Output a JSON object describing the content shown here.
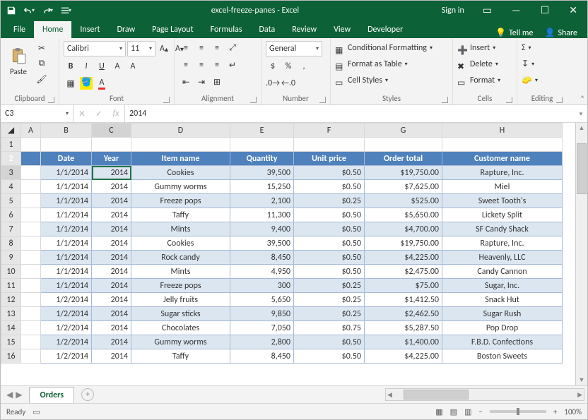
{
  "titlebar": {
    "title": "excel-freeze-panes - Excel",
    "signin": "Sign in"
  },
  "tabs": {
    "file": "File",
    "home": "Home",
    "insert": "Insert",
    "draw": "Draw",
    "pagelayout": "Page Layout",
    "formulas": "Formulas",
    "data": "Data",
    "review": "Review",
    "view": "View",
    "developer": "Developer",
    "tellme": "Tell me",
    "share": "Share"
  },
  "ribbon": {
    "paste": "Paste",
    "font_name": "Calibri",
    "font_size": "11",
    "number_format": "General",
    "cond_fmt": "Conditional Formatting",
    "fmt_table": "Format as Table",
    "cell_styles": "Cell Styles",
    "insert_btn": "Insert",
    "delete_btn": "Delete",
    "format_btn": "Format",
    "groups": {
      "clipboard": "Clipboard",
      "font": "Font",
      "alignment": "Alignment",
      "number": "Number",
      "styles": "Styles",
      "cells": "Cells",
      "editing": "Editing"
    }
  },
  "namebox": "C3",
  "formula": "2014",
  "columns": [
    "A",
    "B",
    "C",
    "D",
    "E",
    "F",
    "G",
    "H"
  ],
  "row_numbers": [
    1,
    2,
    3,
    4,
    5,
    6,
    7,
    8,
    9,
    10,
    11,
    12,
    13,
    14,
    15,
    16
  ],
  "headers": [
    "Date",
    "Year",
    "Item name",
    "Quantity",
    "Unit price",
    "Order total",
    "Customer name"
  ],
  "rows": [
    {
      "date": "1/1/2014",
      "year": "2014",
      "item": "Cookies",
      "qty": "39,500",
      "price": "$0.50",
      "total": "$19,750.00",
      "cust": "Rapture, Inc."
    },
    {
      "date": "1/1/2014",
      "year": "2014",
      "item": "Gummy worms",
      "qty": "15,250",
      "price": "$0.50",
      "total": "$7,625.00",
      "cust": "Miel"
    },
    {
      "date": "1/1/2014",
      "year": "2014",
      "item": "Freeze pops",
      "qty": "2,100",
      "price": "$0.25",
      "total": "$525.00",
      "cust": "Sweet Tooth's"
    },
    {
      "date": "1/1/2014",
      "year": "2014",
      "item": "Taffy",
      "qty": "11,300",
      "price": "$0.50",
      "total": "$5,650.00",
      "cust": "Lickety Split"
    },
    {
      "date": "1/1/2014",
      "year": "2014",
      "item": "Mints",
      "qty": "9,400",
      "price": "$0.50",
      "total": "$4,700.00",
      "cust": "SF Candy Shack"
    },
    {
      "date": "1/1/2014",
      "year": "2014",
      "item": "Cookies",
      "qty": "39,500",
      "price": "$0.50",
      "total": "$19,750.00",
      "cust": "Rapture, Inc."
    },
    {
      "date": "1/1/2014",
      "year": "2014",
      "item": "Rock candy",
      "qty": "8,450",
      "price": "$0.50",
      "total": "$4,225.00",
      "cust": "Heavenly, LLC"
    },
    {
      "date": "1/1/2014",
      "year": "2014",
      "item": "Mints",
      "qty": "4,950",
      "price": "$0.50",
      "total": "$2,475.00",
      "cust": "Candy Cannon"
    },
    {
      "date": "1/1/2014",
      "year": "2014",
      "item": "Freeze pops",
      "qty": "300",
      "price": "$0.25",
      "total": "$75.00",
      "cust": "Sugar, Inc."
    },
    {
      "date": "1/2/2014",
      "year": "2014",
      "item": "Jelly fruits",
      "qty": "5,650",
      "price": "$0.25",
      "total": "$1,412.50",
      "cust": "Snack Hut"
    },
    {
      "date": "1/2/2014",
      "year": "2014",
      "item": "Sugar sticks",
      "qty": "9,850",
      "price": "$0.25",
      "total": "$2,462.50",
      "cust": "Sugar Rush"
    },
    {
      "date": "1/2/2014",
      "year": "2014",
      "item": "Chocolates",
      "qty": "7,050",
      "price": "$0.75",
      "total": "$5,287.50",
      "cust": "Pop Drop"
    },
    {
      "date": "1/2/2014",
      "year": "2014",
      "item": "Gummy worms",
      "qty": "2,800",
      "price": "$0.50",
      "total": "$1,400.00",
      "cust": "F.B.D. Confections"
    },
    {
      "date": "1/2/2014",
      "year": "2014",
      "item": "Taffy",
      "qty": "8,450",
      "price": "$0.50",
      "total": "$4,225.00",
      "cust": "Boston Sweets"
    }
  ],
  "sheet_tab": "Orders",
  "status": {
    "ready": "Ready",
    "zoom": "100%"
  }
}
